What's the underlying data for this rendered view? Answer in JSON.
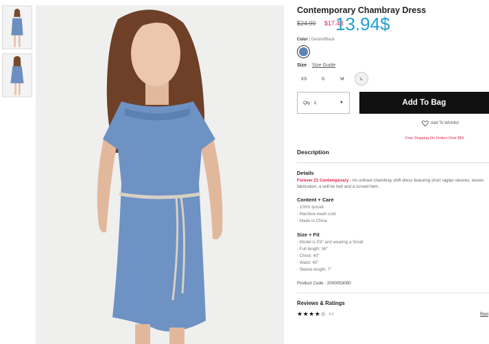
{
  "product": {
    "title": "Contemporary Chambray Dress",
    "old_price": "$24.90",
    "sale_price": "$17.43",
    "overlay_price": "13.94$"
  },
  "color": {
    "label": "Color",
    "value": "Denim/Black",
    "swatch_color": "#5f83b8"
  },
  "size": {
    "label": "Size",
    "guide_label": "Size Guide",
    "options": [
      "XS",
      "S",
      "M",
      "L"
    ],
    "selected": "L"
  },
  "qty": {
    "label": "Qty : 1"
  },
  "actions": {
    "add_to_bag": "Add To Bag",
    "wishlist": "Add To Wishlist",
    "shipping": "Free Shipping On Orders Over $50"
  },
  "description": {
    "heading": "Description",
    "details_heading": "Details",
    "brand": "Forever 21 Contemporary",
    "details_text": " - An unlined chambray shift dress featuring short raglan sleeves, woven fabrication, a self-tie belt and a curved hem.",
    "content_heading": "Content + Care",
    "content_lines": [
      "- 100% lyocell",
      "- Machine wash cold",
      "- Made in China"
    ],
    "fit_heading": "Size + Fit",
    "fit_lines": [
      "- Model is 5'8\" and wearing a Small",
      "- Full length: 36\"",
      "- Chest: 40\"",
      "- Waist: 40\"",
      "- Sleeve length: 7\""
    ],
    "product_code": "Product Code : 2000053080"
  },
  "reviews": {
    "heading": "Reviews & Ratings",
    "stars": "★★★★☆",
    "rating": "4.5",
    "link": "Revi"
  },
  "colors": {
    "sale": "#e0204a",
    "overlay": "#1f9ed4",
    "button": "#111111"
  }
}
